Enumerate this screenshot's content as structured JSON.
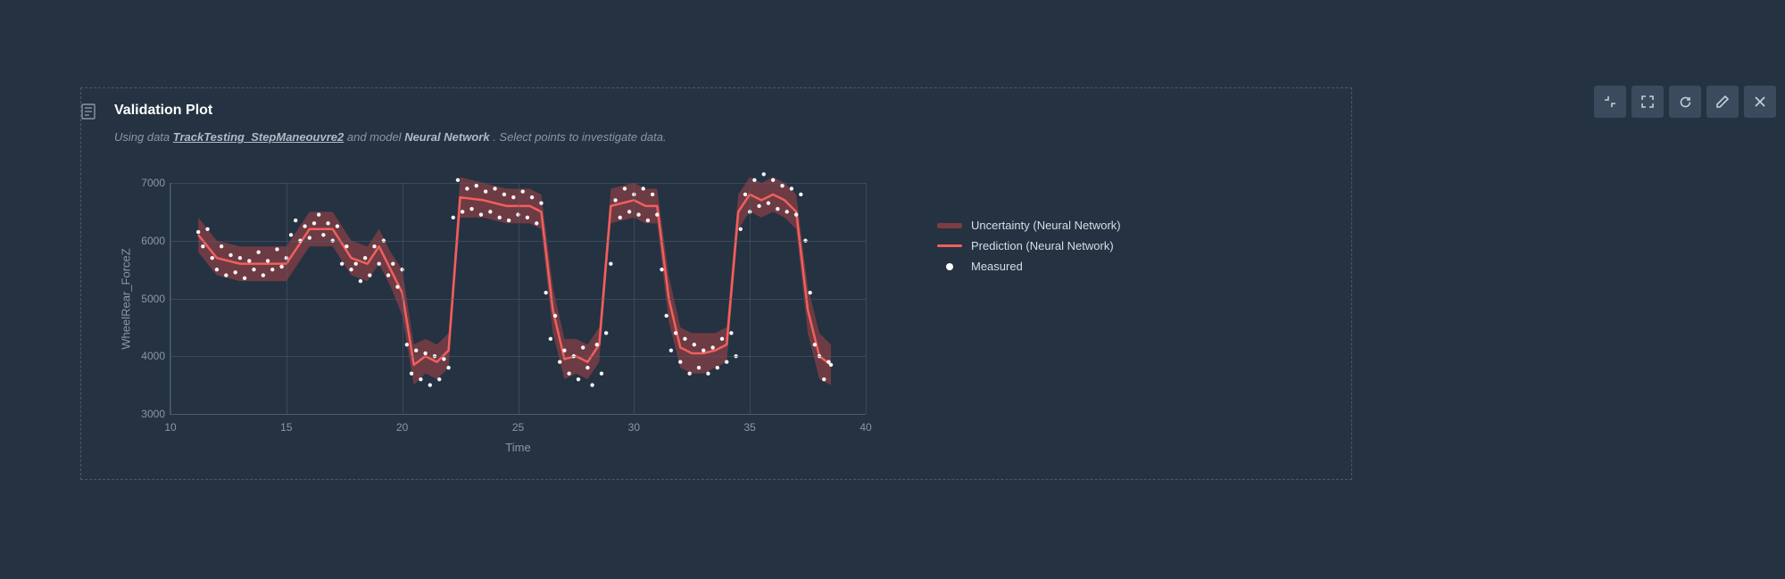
{
  "header": {
    "title": "Validation Plot",
    "sub_prefix": "Using data ",
    "data_link": "TrackTesting_StepManeouvre2",
    "sub_mid": " and model ",
    "model_name": "Neural Network",
    "sub_suffix": ". Select points to investigate data."
  },
  "toolbar": {
    "shrink": "shrink-icon",
    "expand": "expand-icon",
    "refresh": "refresh-icon",
    "edit": "edit-icon",
    "close": "close-icon"
  },
  "legend": {
    "uncertainty": "Uncertainty (Neural Network)",
    "prediction": "Prediction (Neural Network)",
    "measured": "Measured"
  },
  "chart_data": {
    "type": "line",
    "title": "Validation Plot",
    "xlabel": "Time",
    "ylabel": "WheelRear_ForceZ",
    "xlim": [
      10,
      40
    ],
    "ylim": [
      3000,
      7000
    ],
    "xticks": [
      10,
      15,
      20,
      25,
      30,
      35,
      40
    ],
    "yticks": [
      3000,
      4000,
      5000,
      6000,
      7000
    ],
    "series": [
      {
        "name": "Uncertainty (Neural Network)",
        "kind": "band",
        "x": [
          11.2,
          12.0,
          13.0,
          14.0,
          15.0,
          16.0,
          17.0,
          17.8,
          18.5,
          19.0,
          19.5,
          20.0,
          20.5,
          21.0,
          21.5,
          22.0,
          22.5,
          23.5,
          24.5,
          25.5,
          26.0,
          26.5,
          27.0,
          27.5,
          28.0,
          28.5,
          29.0,
          30.0,
          30.5,
          31.0,
          31.5,
          32.0,
          32.5,
          33.0,
          33.5,
          34.0,
          34.5,
          35.0,
          35.5,
          36.0,
          36.5,
          37.0,
          37.5,
          38.0,
          38.5
        ],
        "upper": [
          6400,
          6000,
          5900,
          5900,
          5900,
          6500,
          6500,
          6000,
          5900,
          6200,
          5800,
          5500,
          4200,
          4300,
          4200,
          4400,
          7100,
          7000,
          6900,
          6900,
          6800,
          5200,
          4300,
          4300,
          4200,
          4500,
          6900,
          7000,
          6900,
          6900,
          5400,
          4500,
          4400,
          4400,
          4400,
          4500,
          6800,
          7100,
          7000,
          7100,
          7000,
          6800,
          5200,
          4400,
          4200
        ],
        "lower": [
          5800,
          5400,
          5300,
          5300,
          5300,
          5900,
          5900,
          5400,
          5300,
          5600,
          5200,
          4700,
          3500,
          3700,
          3600,
          3800,
          6400,
          6400,
          6300,
          6300,
          6200,
          4400,
          3600,
          3700,
          3600,
          3900,
          6300,
          6400,
          6300,
          6300,
          4600,
          3800,
          3700,
          3700,
          3800,
          3900,
          6200,
          6500,
          6400,
          6500,
          6400,
          6200,
          4400,
          3600,
          3500
        ]
      },
      {
        "name": "Prediction (Neural Network)",
        "kind": "line",
        "x": [
          11.2,
          12.0,
          13.0,
          14.0,
          15.0,
          16.0,
          17.0,
          17.8,
          18.5,
          19.0,
          19.5,
          20.0,
          20.5,
          21.0,
          21.5,
          22.0,
          22.5,
          23.5,
          24.5,
          25.5,
          26.0,
          26.5,
          27.0,
          27.5,
          28.0,
          28.5,
          29.0,
          30.0,
          30.5,
          31.0,
          31.5,
          32.0,
          32.5,
          33.0,
          33.5,
          34.0,
          34.5,
          35.0,
          35.5,
          36.0,
          36.5,
          37.0,
          37.5,
          38.0,
          38.5
        ],
        "y": [
          6100,
          5700,
          5600,
          5600,
          5600,
          6200,
          6200,
          5700,
          5600,
          5900,
          5500,
          5100,
          3850,
          4000,
          3900,
          4100,
          6750,
          6700,
          6600,
          6600,
          6500,
          4800,
          3950,
          4000,
          3900,
          4200,
          6600,
          6700,
          6600,
          6600,
          5000,
          4150,
          4050,
          4050,
          4100,
          4200,
          6500,
          6800,
          6700,
          6800,
          6700,
          6500,
          4800,
          4000,
          3850
        ]
      },
      {
        "name": "Measured",
        "kind": "scatter",
        "x": [
          11.2,
          11.4,
          11.6,
          11.8,
          12.0,
          12.2,
          12.4,
          12.6,
          12.8,
          13.0,
          13.2,
          13.4,
          13.6,
          13.8,
          14.0,
          14.2,
          14.4,
          14.6,
          14.8,
          15.0,
          15.2,
          15.4,
          15.6,
          15.8,
          16.0,
          16.2,
          16.4,
          16.6,
          16.8,
          17.0,
          17.2,
          17.4,
          17.6,
          17.8,
          18.0,
          18.2,
          18.4,
          18.6,
          18.8,
          19.0,
          19.2,
          19.4,
          19.6,
          19.8,
          20.0,
          20.2,
          20.4,
          20.6,
          20.8,
          21.0,
          21.2,
          21.4,
          21.6,
          21.8,
          22.0,
          22.2,
          22.4,
          22.6,
          22.8,
          23.0,
          23.2,
          23.4,
          23.6,
          23.8,
          24.0,
          24.2,
          24.4,
          24.6,
          24.8,
          25.0,
          25.2,
          25.4,
          25.6,
          25.8,
          26.0,
          26.2,
          26.4,
          26.6,
          26.8,
          27.0,
          27.2,
          27.4,
          27.6,
          27.8,
          28.0,
          28.2,
          28.4,
          28.6,
          28.8,
          29.0,
          29.2,
          29.4,
          29.6,
          29.8,
          30.0,
          30.2,
          30.4,
          30.6,
          30.8,
          31.0,
          31.2,
          31.4,
          31.6,
          31.8,
          32.0,
          32.2,
          32.4,
          32.6,
          32.8,
          33.0,
          33.2,
          33.4,
          33.6,
          33.8,
          34.0,
          34.2,
          34.4,
          34.6,
          34.8,
          35.0,
          35.2,
          35.4,
          35.6,
          35.8,
          36.0,
          36.2,
          36.4,
          36.6,
          36.8,
          37.0,
          37.2,
          37.4,
          37.6,
          37.8,
          38.0,
          38.2,
          38.4,
          38.5
        ],
        "y": [
          6150,
          5900,
          6200,
          5700,
          5500,
          5900,
          5400,
          5750,
          5450,
          5700,
          5350,
          5650,
          5500,
          5800,
          5400,
          5650,
          5500,
          5850,
          5550,
          5700,
          6100,
          6350,
          6000,
          6250,
          6050,
          6300,
          6450,
          6100,
          6300,
          6000,
          6250,
          5600,
          5900,
          5500,
          5600,
          5300,
          5700,
          5400,
          5900,
          5600,
          6000,
          5400,
          5600,
          5200,
          5500,
          4200,
          3700,
          4100,
          3600,
          4050,
          3500,
          4000,
          3600,
          3950,
          3800,
          6400,
          7050,
          6500,
          6900,
          6550,
          6950,
          6450,
          6850,
          6500,
          6900,
          6400,
          6800,
          6350,
          6750,
          6450,
          6850,
          6400,
          6750,
          6300,
          6650,
          5100,
          4300,
          4700,
          3900,
          4100,
          3700,
          4000,
          3600,
          4150,
          3800,
          3500,
          4200,
          3700,
          4400,
          5600,
          6700,
          6400,
          6900,
          6500,
          6800,
          6450,
          6900,
          6350,
          6800,
          6450,
          5500,
          4700,
          4100,
          4400,
          3900,
          4300,
          3700,
          4200,
          3800,
          4100,
          3700,
          4150,
          3800,
          4300,
          3900,
          4400,
          4000,
          6200,
          6800,
          6500,
          7050,
          6600,
          7150,
          6650,
          7050,
          6550,
          6950,
          6500,
          6900,
          6450,
          6800,
          6000,
          5100,
          4200,
          4000,
          3600,
          3900,
          3850
        ]
      }
    ]
  }
}
